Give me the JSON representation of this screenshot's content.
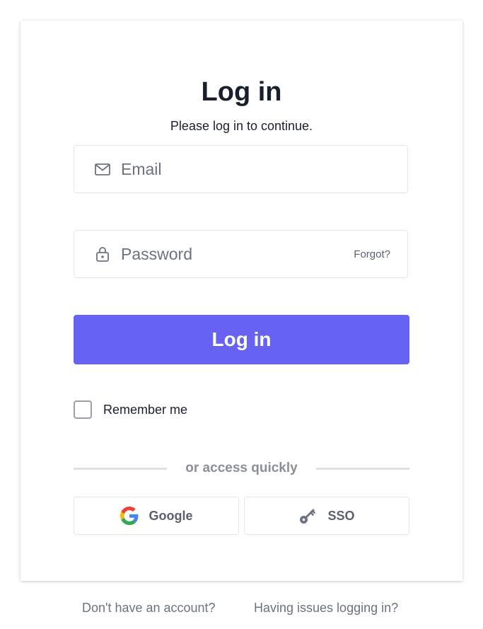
{
  "header": {
    "title": "Log in",
    "subtitle": "Please log in to continue."
  },
  "form": {
    "email_placeholder": "Email",
    "email_value": "",
    "password_placeholder": "Password",
    "password_value": "",
    "forgot_label": "Forgot?",
    "submit_label": "Log in",
    "remember_label": "Remember me",
    "remember_checked": false
  },
  "quick_access": {
    "divider_text": "or access quickly",
    "google_label": "Google",
    "sso_label": "SSO"
  },
  "footer": {
    "signup_link": "Don't have an account?",
    "issues_link": "Having issues logging in?"
  },
  "colors": {
    "primary": "#6862f2",
    "text": "#1a1f2e",
    "muted": "#6b7280"
  },
  "icons": {
    "email": "mail-icon",
    "password": "lock-icon",
    "google": "google-icon",
    "sso": "key-icon"
  }
}
